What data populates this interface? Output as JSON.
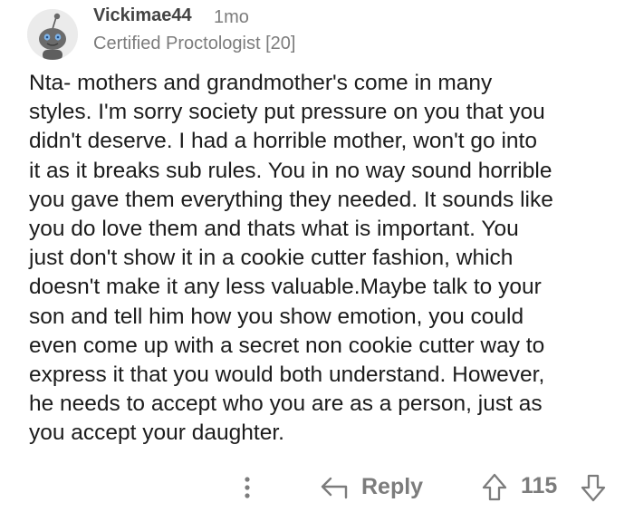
{
  "comment": {
    "username": "Vickimae44",
    "timestamp": "1mo",
    "flair": "Certified Proctologist [20]",
    "body_lines": [
      "Nta-  mothers and grandmother's come in many",
      "styles.  I'm sorry society put pressure on you that you",
      "didn't deserve.  I had a horrible mother, won't go into",
      "it as it breaks sub rules.  You in no way sound horrible",
      "you gave them everything they needed.  It sounds like",
      "you do love them and thats what is important.  You",
      "just don't show it in a cookie cutter fashion, which",
      "doesn't make it any less valuable.Maybe talk to your",
      "son and tell him how you show emotion, you could",
      "even come up with a secret non cookie cutter way to",
      "express it that you would both understand.  However,",
      "he needs to accept who you are as a person, just as",
      "you accept your daughter."
    ]
  },
  "actions": {
    "more_icon": "more-vertical-icon",
    "reply_icon": "reply-arrow-icon",
    "reply_label": "Reply",
    "upvote_icon": "upvote-arrow-icon",
    "score": "115",
    "downvote_icon": "downvote-arrow-icon"
  },
  "colors": {
    "text": "#1c1c1c",
    "meta": "#7c7c7c",
    "username": "#444444",
    "background": "#ffffff"
  }
}
